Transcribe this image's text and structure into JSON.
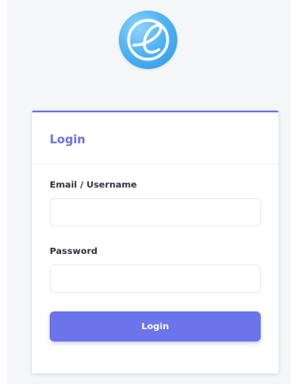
{
  "brand": {
    "logo_icon": "elementary-os-logo-icon",
    "accent_color": "#6b74ea",
    "logo_color": "#4fb4f3"
  },
  "login_card": {
    "title": "Login",
    "email_label": "Email / Username",
    "email_value": "",
    "password_label": "Password",
    "password_value": "",
    "submit_label": "Login"
  }
}
